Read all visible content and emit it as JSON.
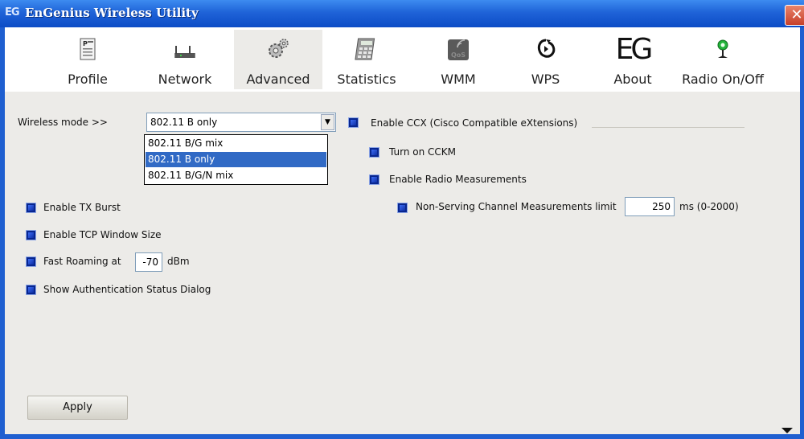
{
  "window": {
    "title": "EnGenius Wireless Utility",
    "logo_text": "EG",
    "close_glyph": "✕"
  },
  "toolbar": {
    "items": [
      {
        "label": "Profile",
        "icon": "profile-icon"
      },
      {
        "label": "Network",
        "icon": "network-icon"
      },
      {
        "label": "Advanced",
        "icon": "gears-icon"
      },
      {
        "label": "Statistics",
        "icon": "calculator-icon"
      },
      {
        "label": "WMM",
        "icon": "qos-icon"
      },
      {
        "label": "WPS",
        "icon": "wps-icon"
      },
      {
        "label": "About",
        "icon": "eg-logo-icon"
      },
      {
        "label": "Radio On/Off",
        "icon": "radio-antenna-icon"
      }
    ],
    "active_index": 2,
    "qos_text": "QoS",
    "about_logo": "EG"
  },
  "advanced": {
    "wireless_mode_label": "Wireless mode >>",
    "wireless_mode_value": "802.11 B only",
    "wireless_mode_options": [
      "802.11 B/G mix",
      "802.11 B only",
      "802.11 B/G/N mix"
    ],
    "wireless_mode_selected_index": 1,
    "enable_tx_burst": "Enable TX Burst",
    "enable_tcp_window": "Enable TCP Window Size",
    "fast_roaming_label": "Fast Roaming at",
    "fast_roaming_value": "-70",
    "fast_roaming_unit": "dBm",
    "show_auth_dialog": "Show Authentication Status Dialog",
    "enable_ccx": "Enable CCX (Cisco Compatible eXtensions)",
    "turn_on_cckm": "Turn on CCKM",
    "enable_radio_meas": "Enable Radio Measurements",
    "non_serving_label": "Non-Serving Channel Measurements limit",
    "non_serving_value": "250",
    "non_serving_unit": "ms (0-2000)",
    "apply_label": "Apply"
  },
  "colors": {
    "titlebar": "#1f63d8",
    "panel": "#ecebe8",
    "selection": "#316ac5",
    "checkbox": "#08268f"
  }
}
